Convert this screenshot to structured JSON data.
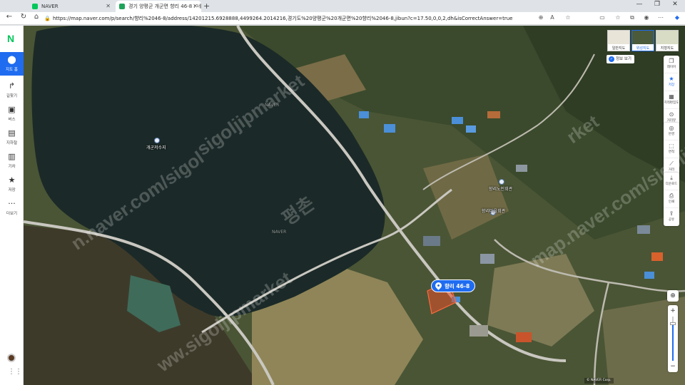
{
  "browser": {
    "tabs": [
      {
        "title": "NAVER",
        "active": false
      },
      {
        "title": "경기 양평군 개군면 향리 46-8 : 네",
        "active": true
      }
    ],
    "new_tab": "+",
    "url": "https://map.naver.com/p/search/향리%2046-8/address/14201215.6928888,4499264.2014216,경기도%20양평군%20개군면%20향리%2046-8,jibun?c=17.50,0,0,2,dh&isCorrectAnswer=true",
    "window_controls": [
      "—",
      "❐",
      "✕"
    ]
  },
  "sidebar": {
    "logo": "N",
    "items": [
      {
        "label": "지도 홈",
        "icon": "location-pin-icon",
        "active": true
      },
      {
        "label": "길찾기",
        "icon": "directions-icon",
        "active": false
      },
      {
        "label": "버스",
        "icon": "bus-icon",
        "active": false
      },
      {
        "label": "지하철",
        "icon": "subway-icon",
        "active": false
      },
      {
        "label": "기차",
        "icon": "train-icon",
        "active": false
      },
      {
        "label": "저장",
        "icon": "star-icon",
        "active": false
      },
      {
        "label": "더보기",
        "icon": "more-icon",
        "active": false
      }
    ],
    "collapse_glyph": "›"
  },
  "map": {
    "labels": [
      {
        "text": "개군저수지"
      },
      {
        "text": "향리노인회관"
      },
      {
        "text": "향리마을회관"
      },
      {
        "text": "NAVER"
      },
      {
        "text": "NAVER"
      }
    ],
    "pin_label": "향리 46-8",
    "watermarks": [
      "sigoljipmarket",
      "평촌",
      "ww.sigoljipmarket",
      "n.naver.com/sigol",
      "rket",
      "map.naver.com/sigoljipmarket"
    ],
    "map_types": [
      {
        "label": "일반지도",
        "active": false
      },
      {
        "label": "위성지도",
        "active": true
      },
      {
        "label": "지형지도",
        "active": false
      }
    ],
    "info_chip": "정보 보기",
    "tools_top": [
      {
        "label": "레이어",
        "icon": "layers-icon",
        "active": false
      },
      {
        "label": "저장",
        "icon": "star-icon",
        "active": true
      },
      {
        "label": "지적편집도",
        "icon": "cadastral-icon",
        "active": false
      },
      {
        "label": "거리뷰",
        "icon": "street-view-icon",
        "active": false
      }
    ],
    "tools_mid": [
      {
        "label": "반경",
        "icon": "radius-icon"
      },
      {
        "label": "면적",
        "icon": "area-icon"
      },
      {
        "label": "거리",
        "icon": "ruler-icon"
      }
    ],
    "tools_bottom": [
      {
        "label": "다운로드",
        "icon": "download-icon"
      },
      {
        "label": "인쇄",
        "icon": "print-icon"
      },
      {
        "label": "공유",
        "icon": "share-icon"
      }
    ],
    "scale_text": "© NAVER Corp."
  },
  "colors": {
    "accent": "#1f6cf0",
    "naver_green": "#03c75a",
    "parcel": "#e8502a"
  }
}
